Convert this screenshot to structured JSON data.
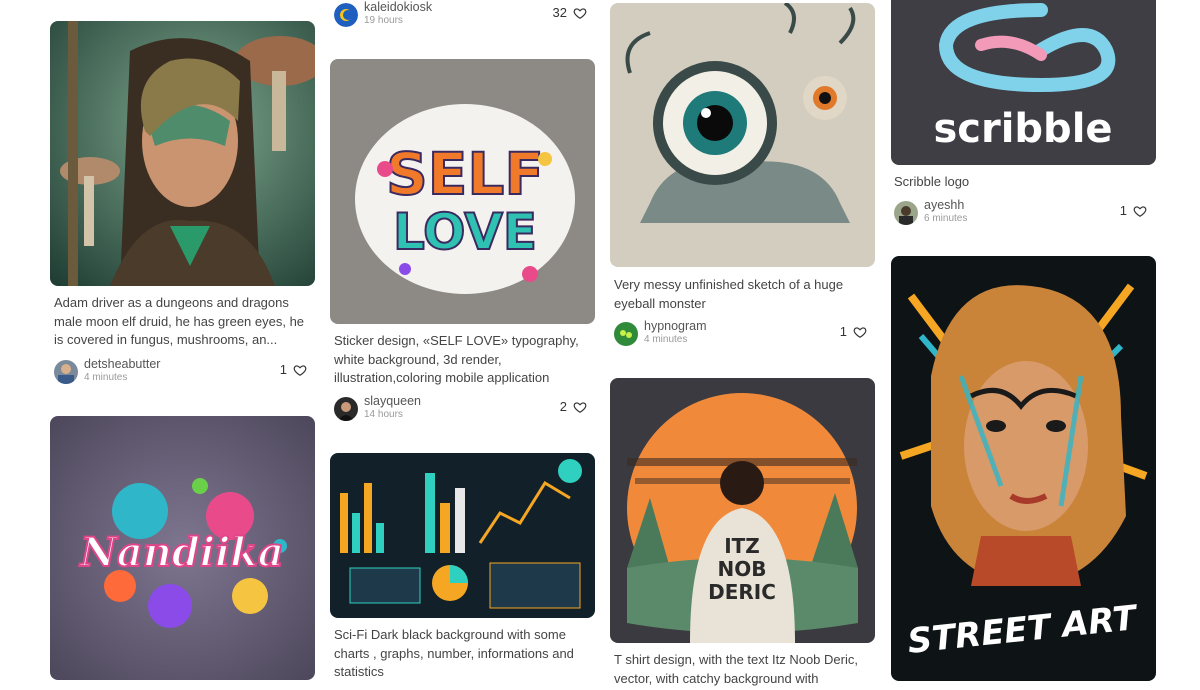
{
  "cards": [
    {
      "caption": "",
      "user": "kaleidokiosk",
      "time": "19 hours",
      "likes": "32"
    },
    {
      "caption": "Adam driver as a dungeons and dragons male moon elf druid, he has green eyes, he is covered in fungus, mushrooms, an...",
      "user": "detsheabutter",
      "time": "4 minutes",
      "likes": "1"
    },
    {
      "caption": "Sticker design, «SELF LOVE» typography, white background, 3d render, illustration,coloring mobile application",
      "user": "slayqueen",
      "time": "14 hours",
      "likes": "2"
    },
    {
      "caption": "Very messy unfinished sketch of a huge eyeball monster",
      "user": "hypnogram",
      "time": "4 minutes",
      "likes": "1"
    },
    {
      "caption": "Scribble logo",
      "user": "ayeshh",
      "time": "6 minutes",
      "likes": "1"
    },
    {
      "caption": "Sci-Fi Dark black background with some charts , graphs, number, informations and statistics"
    },
    {
      "caption": "T shirt design, with the text Itz Noob Deric, vector, with catchy background with"
    }
  ],
  "image_text": {
    "self": "SELF",
    "love": "LOVE",
    "nandika": "Nandiika",
    "scribble": "scribble",
    "tshirt_l1": "ITZ",
    "tshirt_l2": "NOB",
    "tshirt_l3": "DERIC",
    "street_art": "STREET ART"
  },
  "icons": {
    "like": "heart-icon",
    "avatar": "user-avatar"
  },
  "colors": {
    "caption": "#444444",
    "meta": "#9a9a9a",
    "background": "#ffffff"
  }
}
